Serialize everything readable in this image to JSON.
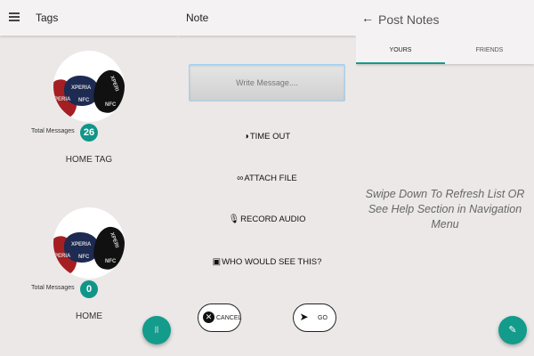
{
  "tags_screen": {
    "title": "Tags",
    "tags": [
      {
        "name": "HOME TAG",
        "count_label": "Total Messages",
        "count": "26",
        "fob_labels": [
          "PERIA",
          "XPERIA",
          "NFC",
          "NFC",
          "XPERI"
        ]
      },
      {
        "name": "HOME",
        "count_label": "Total Messages",
        "count": "0",
        "fob_labels": [
          "PERIA",
          "XPERIA",
          "NFC",
          "NFC",
          "XPERI"
        ]
      }
    ],
    "fab_icon": "nfc-icon"
  },
  "note_screen": {
    "title": "Note",
    "message_placeholder": "Write Message....",
    "actions": {
      "time_out": "TIME OUT",
      "attach_file": "ATTACH FILE",
      "record_audio": "RECORD AUDIO",
      "who_would_see": "WHO WOULD SEE THIS?"
    },
    "cancel_label": "CANCEL",
    "go_label": "GO"
  },
  "post_notes_screen": {
    "title": "Post Notes",
    "tabs": [
      "YOURS",
      "FRIENDS"
    ],
    "active_tab": "YOURS",
    "empty_message": "Swipe Down To Refresh List OR See Help Section in Navigation Menu",
    "fab_icon": "compose-icon"
  },
  "colors": {
    "accent": "#139b8b",
    "background": "#ece8e8",
    "appbar": "#f4f2f2"
  }
}
